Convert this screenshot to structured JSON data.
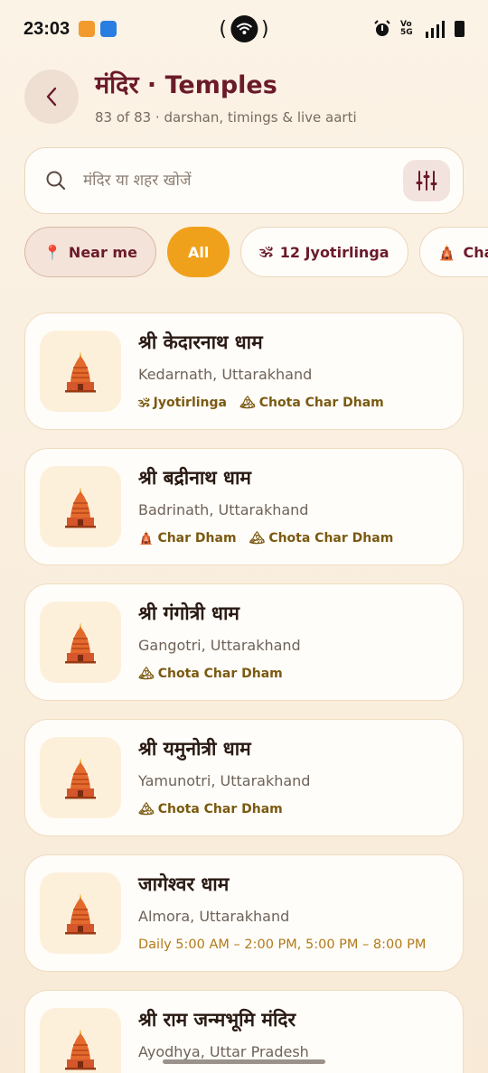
{
  "status_bar": {
    "time": "23:03",
    "network": "5G",
    "volte": "Vo 5G"
  },
  "header": {
    "title": "मंदिर · Temples",
    "subtitle": "83 of 83 · darshan, timings & live aarti"
  },
  "search": {
    "placeholder": "मंदिर या शहर खोजें",
    "value": ""
  },
  "chips": [
    {
      "label": "Near me",
      "icon": "pin-icon",
      "glyph": "📍"
    },
    {
      "label": "All",
      "selected": true
    },
    {
      "label": "12 Jyotirlinga",
      "icon": "om-icon",
      "glyph": "🕉"
    },
    {
      "label": "Char",
      "icon": "temple-icon",
      "glyph": "🛕"
    }
  ],
  "temples": [
    {
      "name": "श्री केदारनाथ धाम",
      "location": "Kedarnath, Uttarakhand",
      "tags": [
        {
          "glyph": "🕉",
          "label": "Jyotirlinga",
          "icon": "om-icon"
        },
        {
          "glyph": "🏔",
          "label": "Chota Char Dham",
          "icon": "mountain-icon"
        }
      ]
    },
    {
      "name": "श्री बद्रीनाथ धाम",
      "location": "Badrinath, Uttarakhand",
      "tags": [
        {
          "glyph": "🛕",
          "label": "Char Dham",
          "icon": "temple-icon"
        },
        {
          "glyph": "🏔",
          "label": "Chota Char Dham",
          "icon": "mountain-icon"
        }
      ]
    },
    {
      "name": "श्री गंगोत्री धाम",
      "location": "Gangotri, Uttarakhand",
      "tags": [
        {
          "glyph": "🏔",
          "label": "Chota Char Dham",
          "icon": "mountain-icon"
        }
      ]
    },
    {
      "name": "श्री यमुनोत्री धाम",
      "location": "Yamunotri, Uttarakhand",
      "tags": [
        {
          "glyph": "🏔",
          "label": "Chota Char Dham",
          "icon": "mountain-icon"
        }
      ]
    },
    {
      "name": "जागेश्वर धाम",
      "location": "Almora, Uttarakhand",
      "timing": "Daily 5:00 AM – 2:00 PM, 5:00 PM – 8:00 PM"
    },
    {
      "name": "श्री राम जन्मभूमि मंदिर",
      "location": "Ayodhya, Uttar Pradesh"
    }
  ],
  "colors": {
    "accent": "#f0a11c",
    "title": "#6b1a2a",
    "tag_text": "#7a5a12"
  }
}
